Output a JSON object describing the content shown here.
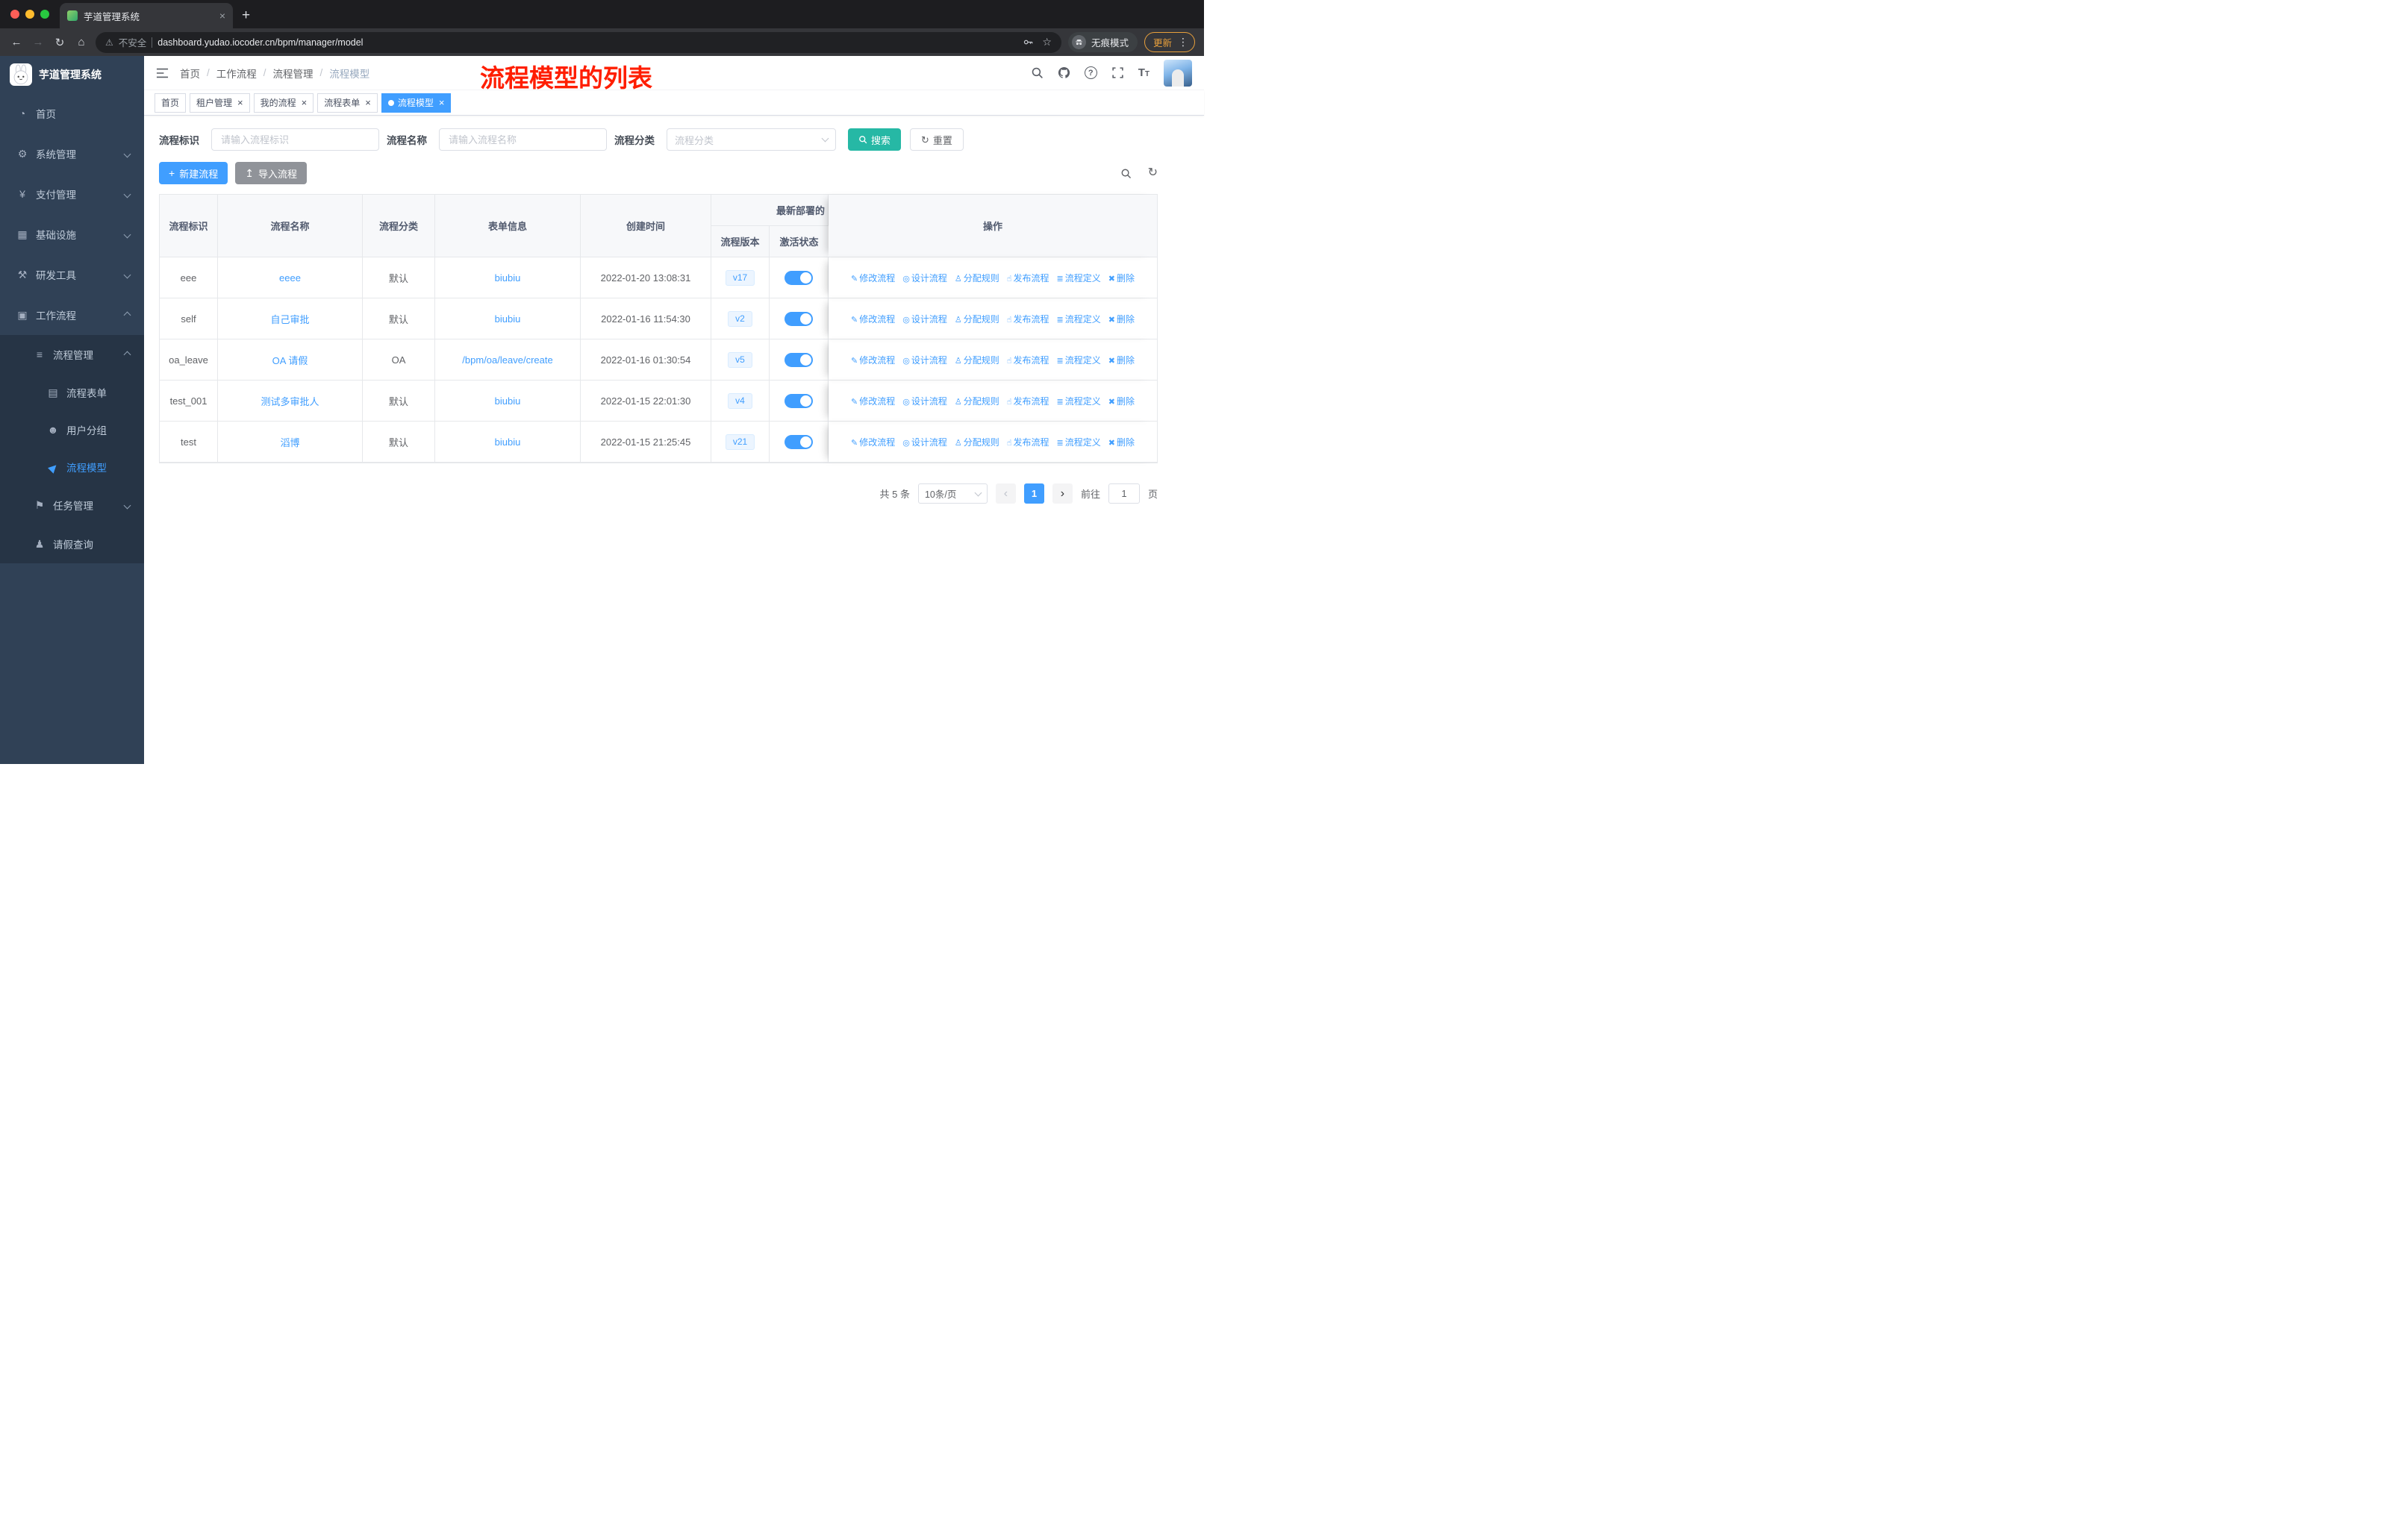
{
  "browser": {
    "tab_title": "芋道管理系统",
    "security_label": "不安全",
    "url": "dashboard.yudao.iocoder.cn/bpm/manager/model",
    "incognito_label": "无痕模式",
    "update_label": "更新"
  },
  "sidebar": {
    "logo_title": "芋道管理系统",
    "menu": [
      {
        "label": "首页",
        "icon": "dashboard-icon",
        "level": 1
      },
      {
        "label": "系统管理",
        "icon": "gear-icon",
        "level": 1,
        "arrow": "down"
      },
      {
        "label": "支付管理",
        "icon": "yen-icon",
        "level": 1,
        "arrow": "down"
      },
      {
        "label": "基础设施",
        "icon": "infrastructure-icon",
        "level": 1,
        "arrow": "down"
      },
      {
        "label": "研发工具",
        "icon": "tools-icon",
        "level": 1,
        "arrow": "down"
      },
      {
        "label": "工作流程",
        "icon": "briefcase-icon",
        "level": 1,
        "arrow": "up"
      },
      {
        "label": "流程管理",
        "icon": "list-icon",
        "level": 2,
        "arrow": "up"
      },
      {
        "label": "流程表单",
        "icon": "document-icon",
        "level": 3
      },
      {
        "label": "用户分组",
        "icon": "usergroup-icon",
        "level": 3
      },
      {
        "label": "流程模型",
        "icon": "paper-plane-icon",
        "level": 3,
        "active": true
      },
      {
        "label": "任务管理",
        "icon": "flag-icon",
        "level": 2,
        "arrow": "down"
      },
      {
        "label": "请假查询",
        "icon": "user-icon",
        "level": 2
      }
    ]
  },
  "header": {
    "breadcrumb": [
      "首页",
      "工作流程",
      "流程管理",
      "流程模型"
    ],
    "annotation": "流程模型的列表"
  },
  "tags": [
    {
      "label": "首页",
      "closable": false,
      "active": false
    },
    {
      "label": "租户管理",
      "closable": true,
      "active": false
    },
    {
      "label": "我的流程",
      "closable": true,
      "active": false
    },
    {
      "label": "流程表单",
      "closable": true,
      "active": false
    },
    {
      "label": "流程模型",
      "closable": true,
      "active": true
    }
  ],
  "filters": {
    "fields": [
      {
        "label": "流程标识",
        "placeholder": "请输入流程标识",
        "type": "input",
        "name": "process-key"
      },
      {
        "label": "流程名称",
        "placeholder": "请输入流程名称",
        "type": "input",
        "name": "process-name"
      },
      {
        "label": "流程分类",
        "placeholder": "流程分类",
        "type": "select",
        "name": "process-category"
      }
    ],
    "search_label": "搜索",
    "reset_label": "重置"
  },
  "toolbar": {
    "create_label": "新建流程",
    "import_label": "导入流程"
  },
  "table": {
    "headers": {
      "id": "流程标识",
      "name": "流程名称",
      "category": "流程分类",
      "form": "表单信息",
      "created": "创建时间",
      "deploy_group": "最新部署的",
      "version": "流程版本",
      "status": "激活状态",
      "actions": "操作"
    },
    "row_actions": [
      {
        "label": "修改流程",
        "icon": "edit-icon"
      },
      {
        "label": "设计流程",
        "icon": "design-icon"
      },
      {
        "label": "分配规则",
        "icon": "assign-icon"
      },
      {
        "label": "发布流程",
        "icon": "publish-icon"
      },
      {
        "label": "流程定义",
        "icon": "definition-icon"
      },
      {
        "label": "删除",
        "icon": "delete-icon"
      }
    ],
    "rows": [
      {
        "id": "eee",
        "name": "eeee",
        "category": "默认",
        "form": "biubiu",
        "created": "2022-01-20 13:08:31",
        "version": "v17",
        "active": true
      },
      {
        "id": "self",
        "name": "自己审批",
        "category": "默认",
        "form": "biubiu",
        "created": "2022-01-16 11:54:30",
        "version": "v2",
        "active": true
      },
      {
        "id": "oa_leave",
        "name": "OA 请假",
        "category": "OA",
        "form": "/bpm/oa/leave/create",
        "created": "2022-01-16 01:30:54",
        "version": "v5",
        "active": true
      },
      {
        "id": "test_001",
        "name": "测试多审批人",
        "category": "默认",
        "form": "biubiu",
        "created": "2022-01-15 22:01:30",
        "version": "v4",
        "active": true
      },
      {
        "id": "test",
        "name": "滔博",
        "category": "默认",
        "form": "biubiu",
        "created": "2022-01-15 21:25:45",
        "version": "v21",
        "active": true
      }
    ]
  },
  "pagination": {
    "total": "共 5 条",
    "page_size": "10条/页",
    "prev": "‹",
    "next": "›",
    "current": "1",
    "goto_label": "前往",
    "goto_value": "1",
    "unit": "页"
  },
  "colors": {
    "accent": "#409eff",
    "teal": "#26b8a5",
    "annotation_red": "#ff1e00",
    "sidebar_bg": "#304156",
    "sidebar_sub_bg": "#263445"
  },
  "icons": [
    "search-icon",
    "github-icon",
    "help-icon",
    "fullscreen-icon",
    "font-size-icon",
    "hamburger-icon",
    "refresh-icon",
    "plus-icon",
    "upload-icon",
    "key-icon",
    "star-icon",
    "incognito-icon",
    "more-menu-icon",
    "warning-icon",
    "back-icon",
    "forward-icon",
    "reload-icon",
    "home-icon",
    "chevron-down-icon",
    "chevron-up-icon"
  ]
}
